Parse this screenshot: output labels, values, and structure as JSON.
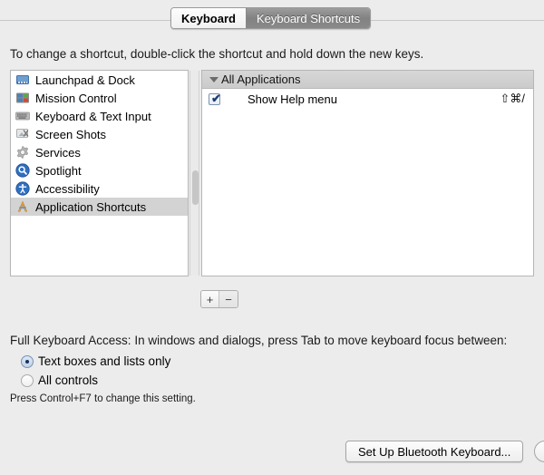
{
  "window": {
    "pane_title": "Keyboard"
  },
  "tabs": [
    {
      "label": "Keyboard",
      "active": false
    },
    {
      "label": "Keyboard Shortcuts",
      "active": true
    }
  ],
  "instruction": "To change a shortcut, double-click the shortcut and hold down the new keys.",
  "sidebar": {
    "items": [
      {
        "label": "Launchpad & Dock",
        "icon": "launchpad-dock-icon",
        "selected": false
      },
      {
        "label": "Mission Control",
        "icon": "mission-control-icon",
        "selected": false
      },
      {
        "label": "Keyboard & Text Input",
        "icon": "keyboard-text-input-icon",
        "selected": false
      },
      {
        "label": "Screen Shots",
        "icon": "screen-shots-icon",
        "selected": false
      },
      {
        "label": "Services",
        "icon": "services-gear-icon",
        "selected": false
      },
      {
        "label": "Spotlight",
        "icon": "spotlight-icon",
        "selected": false
      },
      {
        "label": "Accessibility",
        "icon": "accessibility-icon",
        "selected": false
      },
      {
        "label": "Application Shortcuts",
        "icon": "application-shortcuts-icon",
        "selected": true
      }
    ]
  },
  "shortcuts_panel": {
    "group_header": "All Applications",
    "rows": [
      {
        "checked": true,
        "check_glyph": "✔",
        "name": "Show Help menu",
        "keys": "⇧⌘/"
      }
    ]
  },
  "list_buttons": {
    "add_label": "+",
    "remove_label": "−"
  },
  "full_keyboard_access": {
    "title": "Full Keyboard Access: In windows and dialogs, press Tab to move keyboard focus between:",
    "options": [
      {
        "label": "Text boxes and lists only",
        "selected": true
      },
      {
        "label": "All controls",
        "selected": false
      }
    ],
    "hint": "Press Control+F7 to change this setting."
  },
  "bottom_bar": {
    "bluetooth_button": "Set Up Bluetooth Keyboard...",
    "help_button": "?"
  },
  "colors": {
    "background": "#ececec",
    "panel": "#ffffff",
    "panel_border": "#b6b6b6",
    "selection_inactive": "#d3d3d3",
    "group_header": "#d0d0d0",
    "tab_active_bg": "#8a8a8a",
    "checkbox_blue": "#1d3f73"
  }
}
